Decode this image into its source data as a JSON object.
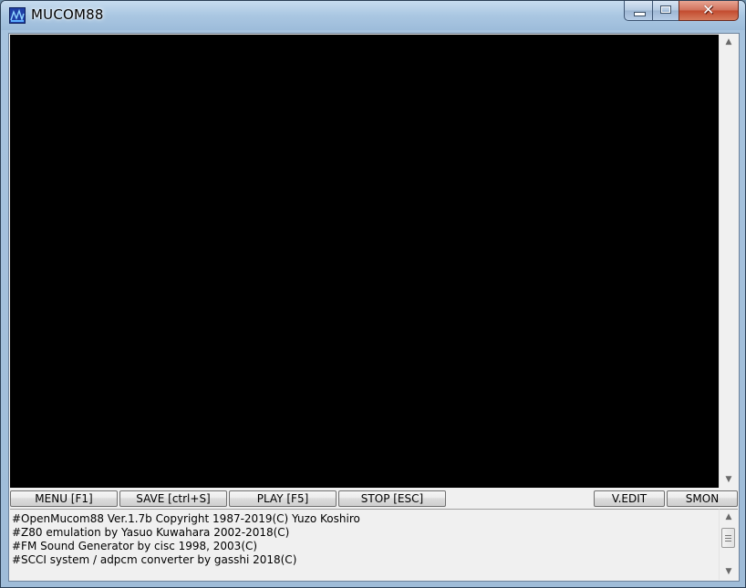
{
  "window": {
    "title": "MUCOM88",
    "icon": "app-icon",
    "caption_buttons": {
      "minimize": "minimize-icon",
      "maximize": "maximize-icon",
      "close_glyph": "✕"
    }
  },
  "toolbar": {
    "menu_label": "MENU [F1]",
    "save_label": "SAVE [ctrl+S]",
    "play_label": "PLAY [F5]",
    "stop_label": "STOP [ESC]",
    "vedit_label": "V.EDIT",
    "smon_label": "SMON"
  },
  "log": {
    "lines": [
      "#OpenMucom88 Ver.1.7b Copyright 1987-2019(C) Yuzo Koshiro",
      "#Z80 emulation by Yasuo Kuwahara 2002-2018(C)",
      "#FM Sound Generator by cisc 1998, 2003(C)",
      "#SCCI system / adpcm converter by gasshi 2018(C)"
    ]
  },
  "colors": {
    "editor_background": "#000000",
    "panel_background": "#f0f0f0",
    "close_button": "#c24a2e"
  }
}
